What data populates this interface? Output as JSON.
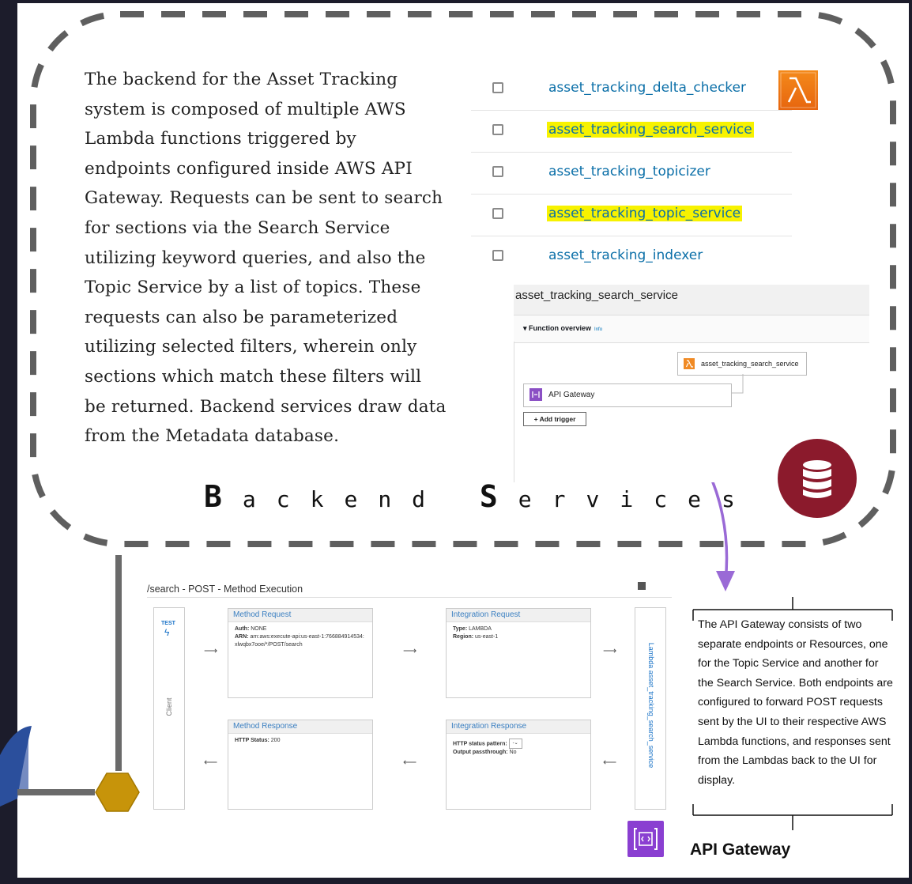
{
  "intro_text": "The backend for the Asset Tracking system is composed of multiple AWS Lambda functions triggered by endpoints configured inside AWS API Gateway. Requests can be sent to search for sections via the Search Service utilizing keyword queries, and also the Topic Service by a  list of topics. These requests can also be parameterized utilizing selected filters, wherein only sections which match these filters will be returned.  Backend services draw data from the Metadata database.",
  "lambda_functions": [
    {
      "name": "asset_tracking_delta_checker",
      "highlighted": false
    },
    {
      "name": "asset_tracking_search_service",
      "highlighted": true
    },
    {
      "name": "asset_tracking_topicizer",
      "highlighted": false
    },
    {
      "name": "asset_tracking_topic_service",
      "highlighted": true
    },
    {
      "name": "asset_tracking_indexer",
      "highlighted": false
    }
  ],
  "function_panel": {
    "title": "asset_tracking_search_service",
    "overview_label": "Function overview",
    "info_label": "Info",
    "function_box_label": "asset_tracking_search_service",
    "trigger_label": "API Gateway",
    "add_trigger_label": "+ Add trigger"
  },
  "section_title": {
    "first_cap": "B",
    "first_rest": "ackend",
    "second_cap": "S",
    "second_rest": "ervices"
  },
  "method_execution": {
    "title": "/search - POST - Method Execution",
    "client_test": "TEST",
    "client_label": "Client",
    "lambda_label": "Lambda asset_tracking_search_service",
    "method_request": {
      "header": "Method Request",
      "auth_label": "Auth:",
      "auth_value": "NONE",
      "arn_label": "ARN:",
      "arn_value": "arn:aws:execute-api:us-east-1:766884914534:xlwqbx7ooe/*/POST/search"
    },
    "integration_request": {
      "header": "Integration Request",
      "type_label": "Type:",
      "type_value": "LAMBDA",
      "region_label": "Region:",
      "region_value": "us-east-1"
    },
    "method_response": {
      "header": "Method Response",
      "status_label": "HTTP Status:",
      "status_value": "200"
    },
    "integration_response": {
      "header": "Integration Response",
      "pattern_label": "HTTP status pattern:",
      "pattern_value": "-",
      "passthrough_label": "Output passthrough:",
      "passthrough_value": "No"
    }
  },
  "gateway_text": "The API Gateway consists of two separate endpoints or Resources, one for the Topic Service and another for the Search Service. Both endpoints are configured to forward POST requests sent by the UI to their respective AWS Lambda functions, and responses sent from the Lambdas back to the UI for display.",
  "gateway_label": "API Gateway",
  "colors": {
    "frame_dark": "#1c1c2b",
    "dash": "#5f5f5f",
    "highlight": "#f7f200",
    "link": "#0b6fa8",
    "lambda_orange": "#ed7418",
    "database": "#8b1a2c",
    "arrow_purple": "#9a6ad6",
    "hexagon": "#c7940a",
    "apigw_purple": "#8a3fd1"
  },
  "icons": [
    "lambda-icon",
    "database-icon",
    "api-gateway-icon",
    "hexagon-connector",
    "lightning-icon",
    "book-icon"
  ]
}
